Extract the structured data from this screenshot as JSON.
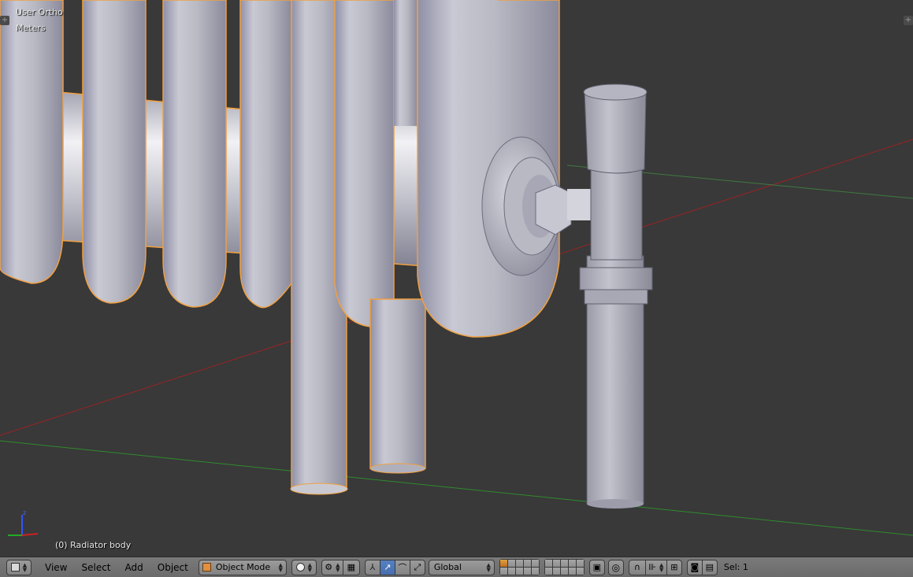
{
  "viewport": {
    "view_name": "User Ortho",
    "units": "Meters",
    "active_object": "(0) Radiator body",
    "axis_label_z": "z"
  },
  "header": {
    "editor_type_icon": "cube-editor-icon",
    "menus": [
      "View",
      "Select",
      "Add",
      "Object"
    ],
    "mode": {
      "label": "Object Mode",
      "icon": "object-mode-cube-icon"
    },
    "shading_icon": "solid-sphere-icon",
    "pivot_icon": "pivot-point-icon",
    "snap_element_icon": "snap-grid-icon",
    "manipulator_icons": [
      "manipulator-axes-icon",
      "translate-arrow-icon",
      "rotate-arc-icon",
      "scale-icon"
    ],
    "orientation": "Global",
    "layer_lock_icon": "lock-layers-icon",
    "proportional_icon": "proportional-edit-icon",
    "snap_icon": "magnet-icon",
    "snap_target_icon": "snap-target-icon",
    "render_icons": [
      "camera-render-icon",
      "clapper-render-icon"
    ],
    "selection_count": "Sel: 1"
  },
  "colors": {
    "viewport_bg": "#393939",
    "selection_outline": "#f0a040",
    "x_axis": "#9b2222",
    "y_axis": "#2e8b2e",
    "active_button": "#5680c2"
  }
}
